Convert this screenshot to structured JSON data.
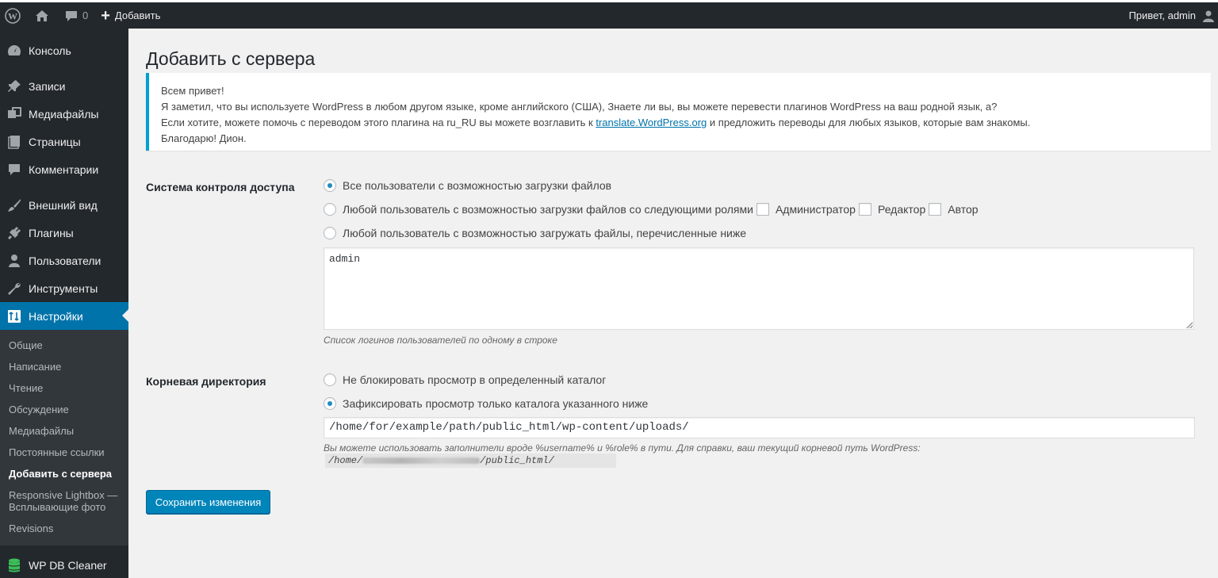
{
  "adminbar": {
    "comments_count": "0",
    "new_label": "Добавить",
    "greeting": "Привет, admin"
  },
  "sidebar": {
    "items": [
      {
        "label": "Консоль",
        "icon": "dashboard-icon"
      },
      {
        "label": "Записи",
        "icon": "pin-icon"
      },
      {
        "label": "Медиафайлы",
        "icon": "media-icon"
      },
      {
        "label": "Страницы",
        "icon": "page-icon"
      },
      {
        "label": "Комментарии",
        "icon": "comment-icon"
      },
      {
        "label": "Внешний вид",
        "icon": "brush-icon"
      },
      {
        "label": "Плагины",
        "icon": "plugin-icon"
      },
      {
        "label": "Пользователи",
        "icon": "users-icon"
      },
      {
        "label": "Инструменты",
        "icon": "wrench-icon"
      },
      {
        "label": "Настройки",
        "icon": "settings-icon"
      }
    ],
    "submenu": [
      "Общие",
      "Написание",
      "Чтение",
      "Обсуждение",
      "Медиафайлы",
      "Постоянные ссылки",
      "Добавить с сервера",
      "Responsive Lightbox — Всплывающие фото",
      "Revisions"
    ],
    "db_cleaner": "WP DB Cleaner"
  },
  "page": {
    "title": "Добавить с сервера"
  },
  "notice": {
    "line1": "Всем привет!",
    "line2": "Я заметил, что вы используете WordPress в любом другом языке, кроме английского (США), Знаете ли вы, вы можете перевести плагинов WordPress на ваш родной язык, а?",
    "line3_before": "Если хотите, можете помочь с переводом этого плагина на ru_RU вы можете возглавить к",
    "line3_link": "translate.WordPress.org",
    "line3_after": "и предложить переводы для любых языков, которые вам знакомы.",
    "line4": "Благодарю! Дион."
  },
  "access": {
    "label": "Система контроля доступа",
    "option1": "Все пользователи с возможностью загрузки файлов",
    "option2": "Любой пользователь с возможностью загрузки файлов со следующими ролями",
    "roles": [
      "Администратор",
      "Редактор",
      "Автор"
    ],
    "option3": "Любой пользователь с возможностью загружать файлы, перечисленные ниже",
    "users_value": "admin",
    "users_desc": "Список логинов пользователей по одному в строке"
  },
  "root": {
    "label": "Корневая директория",
    "option1": "Не блокировать просмотр в определенный каталог",
    "option2": "Зафиксировать просмотр только каталога указанного ниже",
    "path_value": "/home/for/example/path/public_html/wp-content/uploads/",
    "desc": "Вы можете использовать заполнители вроде %username% и %role% в пути.  Для справки, ваш текущий корневой путь WordPress:",
    "path_start": "/home/",
    "path_end": "/public_html/"
  },
  "save_label": "Сохранить изменения",
  "colors": {
    "adminbar": "#23282d",
    "accent": "#0073aa",
    "notice_border": "#00a0d2",
    "button": "#0085ba"
  }
}
